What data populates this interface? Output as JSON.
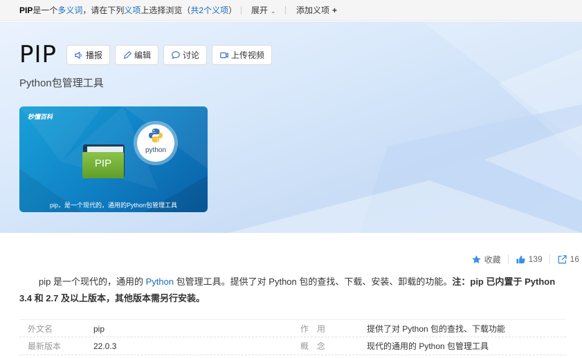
{
  "polysemy_bar": {
    "prefix_bold": "PIP",
    "prefix_text": "是一个",
    "link_polysemy": "多义词",
    "middle_text": "，请在下列",
    "link_item": "义项",
    "after_text": "上选择浏览（",
    "link_count": "共2个义项",
    "close_paren": "）",
    "expand_label": "展开",
    "add_label": "添加义项",
    "add_icon": "plus-icon"
  },
  "header": {
    "title": "PIP",
    "subtitle": "Python包管理工具",
    "actions": [
      {
        "label": "播报",
        "icon": "speaker-icon"
      },
      {
        "label": "编辑",
        "icon": "pencil-icon"
      },
      {
        "label": "讨论",
        "icon": "chat-bubble-icon"
      },
      {
        "label": "上传视频",
        "icon": "video-camera-icon"
      }
    ]
  },
  "video": {
    "logo_text": "秒懂百科",
    "folder_label": "PIP",
    "python_text": "python",
    "caption": "pip，是一个现代的，通用的Python包管理工具"
  },
  "stats": {
    "favorite_label": "收藏",
    "likes": "139",
    "shares": "16"
  },
  "summary": {
    "part1": "pip 是一个现代的，通用的 ",
    "link": "Python",
    "part2": " 包管理工具。提供了对 Python 包的查找、下载、安装、卸载的功能。",
    "bold": "注：pip 已内置于 Python 3.4 和 2.7 及以上版本，其他版本需另行安装。"
  },
  "basic_info": [
    {
      "k1": "外文名",
      "v1": "pip",
      "k2": "作用",
      "v2": "提供了对 Python 包的查找、下载功能"
    },
    {
      "k1": "最新版本",
      "v1": "22.0.3",
      "k2": "概念",
      "v2": "现代的通用的 Python 包管理工具"
    }
  ],
  "colors": {
    "link": "#136ec2",
    "accent_star": "#3b8ee8",
    "hero_bg": "#d9e9fb"
  }
}
